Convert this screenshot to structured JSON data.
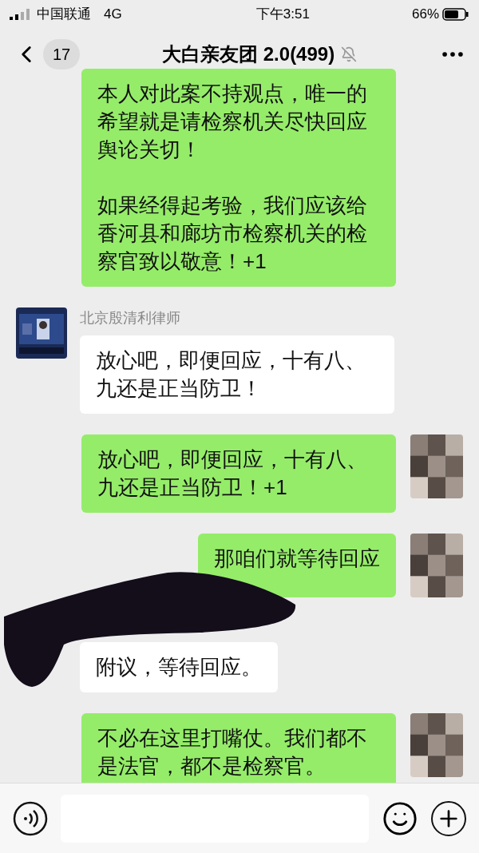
{
  "status_bar": {
    "carrier": "中国联通",
    "network": "4G",
    "time": "下午3:51",
    "battery": "66%"
  },
  "header": {
    "back_count": "17",
    "title": "大白亲友团 2.0(499)"
  },
  "messages": [
    {
      "kind": "sent",
      "paragraphs": [
        "本人对此案不持观点，唯一的希望就是请检察机关尽快回应舆论关切！",
        "如果经得起考验，我们应该给香河县和廊坊市检察机关的检察官致以敬意！+1"
      ],
      "avatar_shown": false
    },
    {
      "kind": "received",
      "sender": "北京殷清利律师",
      "paragraphs": [
        "放心吧，即便回应，十有八、九还是正当防卫！"
      ],
      "redacted": false
    },
    {
      "kind": "sent",
      "paragraphs": [
        "放心吧，即便回应，十有八、九还是正当防卫！+1"
      ],
      "avatar_shown": true
    },
    {
      "kind": "sent",
      "paragraphs": [
        "那咱们就等待回应"
      ],
      "avatar_shown": true
    },
    {
      "kind": "received",
      "paragraphs": [
        "附议，等待回应。"
      ],
      "redacted": true
    },
    {
      "kind": "sent",
      "paragraphs": [
        "不必在这里打嘴仗。我们都不是法官，都不是检察官。"
      ],
      "avatar_shown": true
    }
  ]
}
